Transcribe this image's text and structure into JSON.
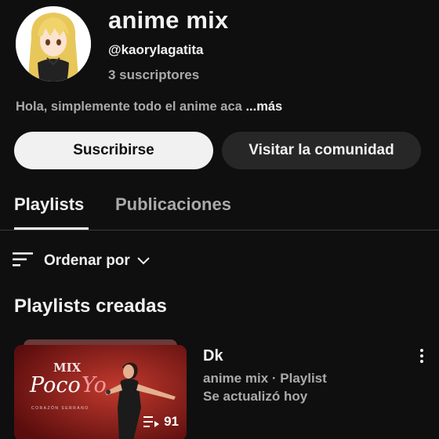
{
  "channel": {
    "name": "anime mix",
    "handle": "@kaorylagatita",
    "subscribers": "3 suscriptores",
    "description": "Hola, simplemente todo el anime aca ",
    "more_label": "...más",
    "avatar_icon": "anime-girl-avatar"
  },
  "buttons": {
    "subscribe": "Suscribirse",
    "community": "Visitar la comunidad"
  },
  "tabs": [
    {
      "label": "Playlists",
      "selected": true
    },
    {
      "label": "Publicaciones",
      "selected": false
    }
  ],
  "sort": {
    "label": "Ordenar por",
    "icon": "sort-lines-icon"
  },
  "section": {
    "title": "Playlists creadas"
  },
  "playlists": [
    {
      "title": "Dk",
      "meta": "anime mix · Playlist",
      "updated": "Se actualizó hoy",
      "video_count": "91",
      "thumbnail": {
        "top_text": "MIX",
        "main_text_1": "Poco",
        "main_text_2": "Yo",
        "caption": "CORAZÓN SERRANO"
      }
    }
  ],
  "colors": {
    "background": "#0f0f0f",
    "primary_text": "#f1f1f1",
    "secondary_text": "#aaaaaa",
    "subscribe_bg": "#f1f1f1",
    "community_bg": "#272727"
  }
}
